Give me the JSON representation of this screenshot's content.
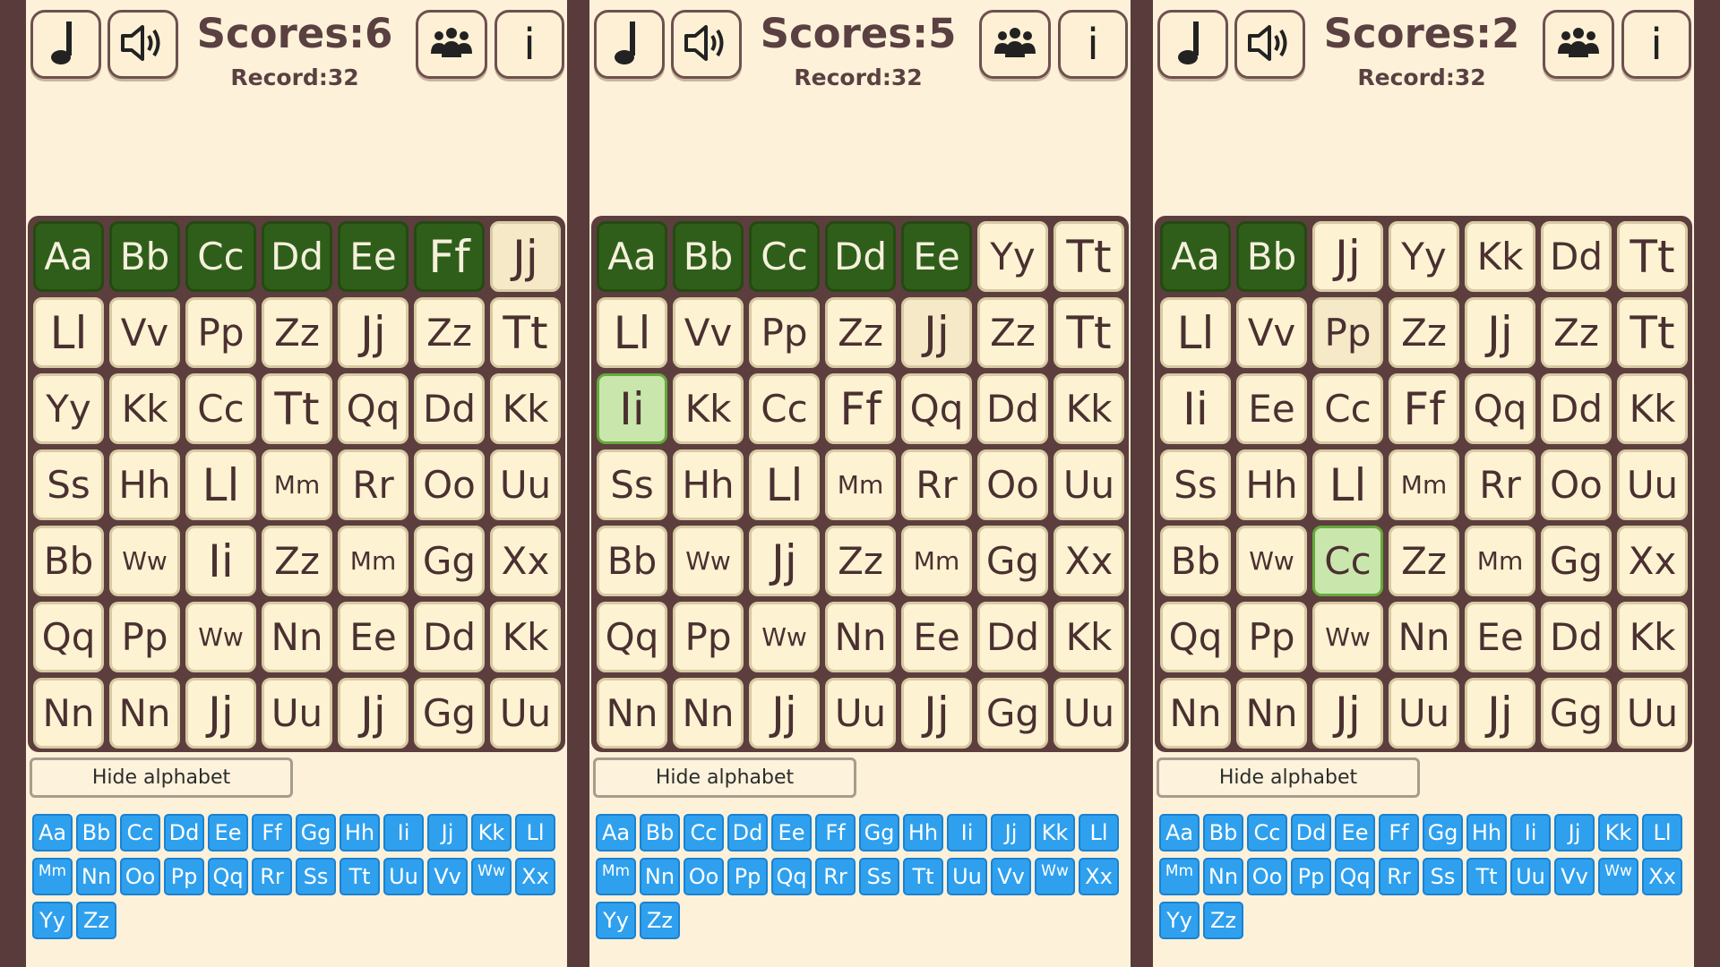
{
  "colors": {
    "background": "#5a3b3b",
    "panel": "#fdf1d9",
    "board": "#5c3e3e",
    "tile": "#fdf3d2",
    "tile_done": "#2f5e1a",
    "tile_selected": "#c9e6ac",
    "key": "#2ea0ee"
  },
  "icons": [
    "music-note-icon",
    "speaker-icon",
    "people-icon",
    "info-icon"
  ],
  "info_label": "i",
  "hide_label": "Hide alphabet",
  "keyboard": [
    "Aa",
    "Bb",
    "Cc",
    "Dd",
    "Ee",
    "Ff",
    "Gg",
    "Hh",
    "Ii",
    "Jj",
    "Kk",
    "Ll",
    "Mm",
    "Nn",
    "Oo",
    "Pp",
    "Qq",
    "Rr",
    "Ss",
    "Tt",
    "Uu",
    "Vv",
    "Ww",
    "Xx",
    "Yy",
    "Zz"
  ],
  "panels": [
    {
      "score": "Scores:6",
      "record": "Record:32",
      "grid": [
        [
          "Aa",
          "Bb",
          "Cc",
          "Dd",
          "Ee",
          "Ff",
          "Jj"
        ],
        [
          "Ll",
          "Vv",
          "Pp",
          "Zz",
          "Jj",
          "Zz",
          "Tt"
        ],
        [
          "Yy",
          "Kk",
          "Cc",
          "Tt",
          "Qq",
          "Dd",
          "Kk"
        ],
        [
          "Ss",
          "Hh",
          "Ll",
          "Mm",
          "Rr",
          "Oo",
          "Uu"
        ],
        [
          "Bb",
          "Ww",
          "Ii",
          "Zz",
          "Mm",
          "Gg",
          "Xx"
        ],
        [
          "Qq",
          "Pp",
          "Ww",
          "Nn",
          "Ee",
          "Dd",
          "Kk"
        ],
        [
          "Nn",
          "Nn",
          "Jj",
          "Uu",
          "Jj",
          "Gg",
          "Uu"
        ]
      ],
      "done": [
        [
          0,
          0
        ],
        [
          0,
          1
        ],
        [
          0,
          2
        ],
        [
          0,
          3
        ],
        [
          0,
          4
        ],
        [
          0,
          5
        ]
      ],
      "selected": [],
      "highlighted": [
        [
          0,
          6
        ]
      ]
    },
    {
      "score": "Scores:5",
      "record": "Record:32",
      "grid": [
        [
          "Aa",
          "Bb",
          "Cc",
          "Dd",
          "Ee",
          "Yy",
          "Tt"
        ],
        [
          "Ll",
          "Vv",
          "Pp",
          "Zz",
          "Jj",
          "Zz",
          "Tt"
        ],
        [
          "Ii",
          "Kk",
          "Cc",
          "Ff",
          "Qq",
          "Dd",
          "Kk"
        ],
        [
          "Ss",
          "Hh",
          "Ll",
          "Mm",
          "Rr",
          "Oo",
          "Uu"
        ],
        [
          "Bb",
          "Ww",
          "Jj",
          "Zz",
          "Mm",
          "Gg",
          "Xx"
        ],
        [
          "Qq",
          "Pp",
          "Ww",
          "Nn",
          "Ee",
          "Dd",
          "Kk"
        ],
        [
          "Nn",
          "Nn",
          "Jj",
          "Uu",
          "Jj",
          "Gg",
          "Uu"
        ]
      ],
      "done": [
        [
          0,
          0
        ],
        [
          0,
          1
        ],
        [
          0,
          2
        ],
        [
          0,
          3
        ],
        [
          0,
          4
        ]
      ],
      "selected": [
        [
          2,
          0
        ]
      ],
      "highlighted": [
        [
          1,
          4
        ]
      ]
    },
    {
      "score": "Scores:2",
      "record": "Record:32",
      "grid": [
        [
          "Aa",
          "Bb",
          "Jj",
          "Yy",
          "Kk",
          "Dd",
          "Tt"
        ],
        [
          "Ll",
          "Vv",
          "Pp",
          "Zz",
          "Jj",
          "Zz",
          "Tt"
        ],
        [
          "Ii",
          "Ee",
          "Cc",
          "Ff",
          "Qq",
          "Dd",
          "Kk"
        ],
        [
          "Ss",
          "Hh",
          "Ll",
          "Mm",
          "Rr",
          "Oo",
          "Uu"
        ],
        [
          "Bb",
          "Ww",
          "Cc",
          "Zz",
          "Mm",
          "Gg",
          "Xx"
        ],
        [
          "Qq",
          "Pp",
          "Ww",
          "Nn",
          "Ee",
          "Dd",
          "Kk"
        ],
        [
          "Nn",
          "Nn",
          "Jj",
          "Uu",
          "Jj",
          "Gg",
          "Uu"
        ]
      ],
      "done": [
        [
          0,
          0
        ],
        [
          0,
          1
        ]
      ],
      "selected": [
        [
          4,
          2
        ]
      ],
      "highlighted": [
        [
          1,
          2
        ]
      ]
    }
  ]
}
